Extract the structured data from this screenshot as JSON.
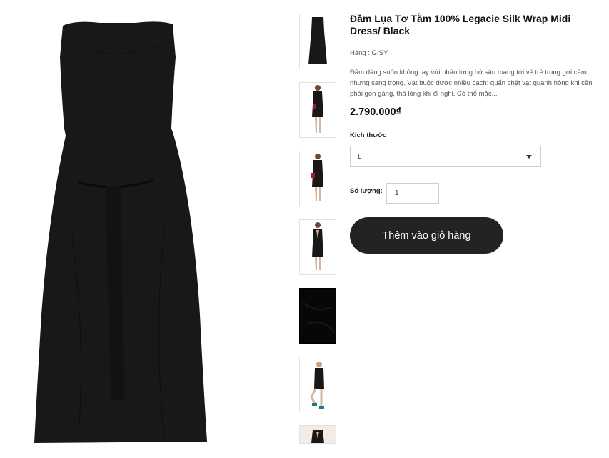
{
  "product": {
    "title": "Đầm Lụa Tơ Tằm 100% Legacie Silk Wrap Midi Dress/ Black",
    "brand_line": "Hãng : GISY",
    "description": "Đầm dáng suôn không tay với phần lưng hở sâu mang tới vẻ trẻ trung gợi cảm nhưng sang trọng. Vạt buộc được nhiều cách: quấn chặt vạt quanh hông khi cần phải gọn gàng, thả lỏng khi đi nghỉ. Có thể mặc...",
    "price": "2.790.000₫"
  },
  "options": {
    "size_label": "Kích thước",
    "size_value": "L",
    "quantity_label": "Số lượng:",
    "quantity_value": "1"
  },
  "actions": {
    "add_to_cart": "Thêm vào giỏ hàng"
  },
  "gallery": {
    "thumbnails": [
      "dress-front",
      "model-front",
      "model-front-red-bag",
      "model-back",
      "fabric-detail",
      "model-pose-teal-heels",
      "model-back-partial"
    ]
  },
  "colors": {
    "dress": "#1a1719",
    "button_bg": "#232323",
    "button_text": "#ffffff"
  }
}
